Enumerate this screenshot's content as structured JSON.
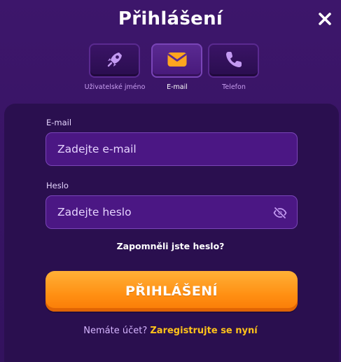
{
  "modal": {
    "title": "Přihlášení"
  },
  "tabs": [
    {
      "label": "Uživatelské jméno",
      "icon": "rocket-icon",
      "active": false
    },
    {
      "label": "E-mail",
      "icon": "envelope-icon",
      "active": true
    },
    {
      "label": "Telefon",
      "icon": "phone-icon",
      "active": false
    }
  ],
  "form": {
    "email_label": "E-mail",
    "email_placeholder": "Zadejte e-mail",
    "password_label": "Heslo",
    "password_placeholder": "Zadejte heslo",
    "forgot_label": "Zapomněli jste heslo?",
    "submit_label": "PŘIHLÁŠENÍ"
  },
  "signup": {
    "prompt": "Nemáte účet?",
    "link_label": "Zaregistrujte se nyní"
  },
  "colors": {
    "accent": "#ff8f12",
    "link": "#ffc21a",
    "envelope": "#ffa51f",
    "icon_purple": "#c39af2"
  }
}
